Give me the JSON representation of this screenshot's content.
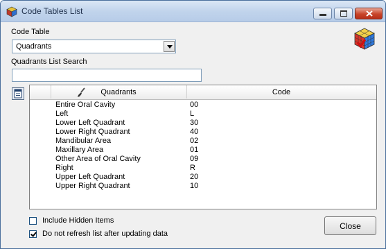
{
  "window": {
    "title": "Code Tables List",
    "title_icon": "cube-app-icon",
    "controls": {
      "minimize": "minimize-icon",
      "maximize": "maximize-icon",
      "close": "close-icon"
    }
  },
  "code_table": {
    "label": "Code Table",
    "selected": "Quadrants"
  },
  "search": {
    "label": "Quadrants List Search",
    "value": "",
    "placeholder": ""
  },
  "grid": {
    "columns": [
      "Quadrants",
      "Code"
    ],
    "rows": [
      {
        "name": "Entire Oral Cavity",
        "code": "00"
      },
      {
        "name": "Left",
        "code": "L"
      },
      {
        "name": "Lower Left Quadrant",
        "code": "30"
      },
      {
        "name": "Lower Right Quadrant",
        "code": "40"
      },
      {
        "name": "Mandibular Area",
        "code": "02"
      },
      {
        "name": "Maxillary Area",
        "code": "01"
      },
      {
        "name": "Other Area of Oral Cavity",
        "code": "09"
      },
      {
        "name": "Right",
        "code": "R"
      },
      {
        "name": "Upper Left Quadrant",
        "code": "20"
      },
      {
        "name": "Upper Right Quadrant",
        "code": "10"
      }
    ]
  },
  "options": {
    "include_hidden": {
      "label": "Include Hidden Items",
      "checked": false
    },
    "no_refresh": {
      "label": "Do not refresh list after updating data",
      "checked": true
    }
  },
  "buttons": {
    "close": "Close"
  },
  "colors": {
    "titlebar": "#c1d4ec",
    "window_bg": "#f0f0f0",
    "close_red": "#c8452b"
  }
}
